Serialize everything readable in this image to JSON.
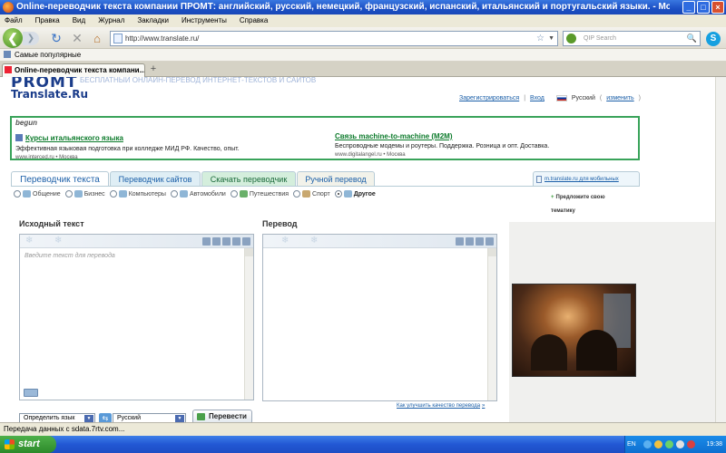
{
  "window": {
    "title": "Online-переводчик текста компании ПРОМТ: английский, русский, немецкий, французский, испанский, итальянский и португальский языки. - Mozilla Firefox",
    "buttons": [
      "_",
      "□",
      "×"
    ]
  },
  "menu": [
    "Файл",
    "Правка",
    "Вид",
    "Журнал",
    "Закладки",
    "Инструменты",
    "Справка"
  ],
  "nav": {
    "back": "❮",
    "forward": "❯",
    "reload": "↻",
    "stop": "✕",
    "home": "⌂",
    "url": "http://www.translate.ru/",
    "star": "☆",
    "dropdown": "▼",
    "search_placeholder": "QIP Search",
    "search_icon": "🔍"
  },
  "bookmarks": {
    "label": "Самые популярные"
  },
  "browser_tab": {
    "label": "Online-переводчик текста компани...",
    "new_tab": "+"
  },
  "site": {
    "logo_line1": "PROMT",
    "logo_line2": "Translate.Ru",
    "logo_tagline": "БЕСПЛАТНЫЙ ОНЛАЙН-ПЕРЕВОД ИНТЕРНЕТ-ТЕКСТОВ И САЙТОВ",
    "register": "Зарегистрироваться",
    "login": "Вход",
    "language": "Русский",
    "change": "изменить",
    "sep": "|"
  },
  "ads": {
    "label": "begun",
    "items": [
      {
        "title": "Курсы итальянского языка",
        "desc": "Эффективная языковая подготовка при колледже МИД РФ. Качество, опыт.",
        "url": "www.interced.ru • Москва"
      },
      {
        "title": "Связь machine-to-machine (M2M)",
        "desc": "Беспроводные модемы и роутеры. Поддержка. Розница и опт. Доставка.",
        "url": "www.digitalangel.ru • Москва"
      }
    ]
  },
  "tabs": [
    "Переводчик текста",
    "Переводчик сайтов",
    "Скачать переводчик",
    "Ручной перевод"
  ],
  "mobile_link": "m.translate.ru для мобильных",
  "subjects": [
    "Общение",
    "Бизнес",
    "Компьютеры",
    "Автомобили",
    "Путешествия",
    "Спорт",
    "Другое"
  ],
  "active_subject": "Другое",
  "suggest": {
    "plus": "+",
    "line1": "Предложите свою",
    "line2": "тематику"
  },
  "source": {
    "label": "Исходный текст",
    "placeholder": "Введите текст для перевода"
  },
  "target": {
    "label": "Перевод"
  },
  "improve_link": "Как улучшить качество перевода",
  "improve_arrow": "»",
  "controls": {
    "from": "Определить язык",
    "to": "Русский",
    "translate": "Перевести",
    "swap": "⇆"
  },
  "status": "Передача данных с sdata.7rtv.com...",
  "taskbar": {
    "start": "start",
    "lang": "EN",
    "time": "19:38"
  }
}
